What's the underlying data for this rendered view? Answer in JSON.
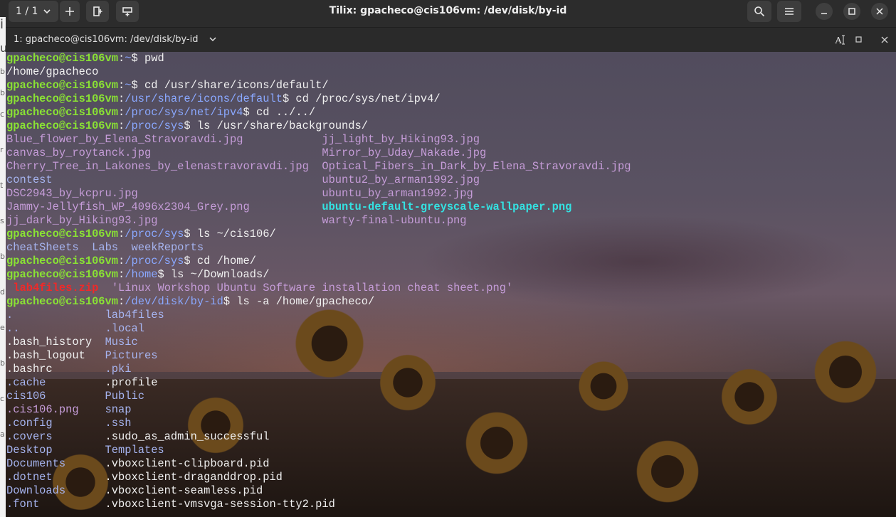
{
  "window": {
    "title": "Tilix: gpacheco@cis106vm: /dev/disk/by-id",
    "session_counter": "1 / 1"
  },
  "terminal": {
    "title": "1: gpacheco@cis106vm: /dev/disk/by-id"
  },
  "icons": [
    "chevron-down-icon",
    "plus-icon",
    "add-terminal-right-icon",
    "add-terminal-down-icon",
    "search-icon",
    "hamburger-menu-icon",
    "minimize-icon",
    "maximize-icon",
    "close-icon",
    "text-cursor-icon",
    "terminal-maximize-icon",
    "terminal-close-icon"
  ],
  "colors": {
    "prompt_user": "#8ae234",
    "prompt_path": "#8aa8ff",
    "directory": "#a6b4f0",
    "image_file": "#c59cd8",
    "link_file": "#34e2e2",
    "archive": "#ef2929"
  },
  "lines": [
    [
      {
        "t": "gpacheco@cis106vm",
        "c": "g"
      },
      {
        "t": ":",
        "c": "plain"
      },
      {
        "t": "~",
        "c": "b"
      },
      {
        "t": "$ pwd",
        "c": "cmd"
      }
    ],
    [
      {
        "t": "/home/gpacheco",
        "c": "plain"
      }
    ],
    [
      {
        "t": "gpacheco@cis106vm",
        "c": "g"
      },
      {
        "t": ":",
        "c": "plain"
      },
      {
        "t": "~",
        "c": "b"
      },
      {
        "t": "$ cd /usr/share/icons/default/",
        "c": "cmd"
      }
    ],
    [
      {
        "t": "gpacheco@cis106vm",
        "c": "g"
      },
      {
        "t": ":",
        "c": "plain"
      },
      {
        "t": "/usr/share/icons/default",
        "c": "b"
      },
      {
        "t": "$ cd /proc/sys/net/ipv4/",
        "c": "cmd"
      }
    ],
    [
      {
        "t": "gpacheco@cis106vm",
        "c": "g"
      },
      {
        "t": ":",
        "c": "plain"
      },
      {
        "t": "/proc/sys/net/ipv4",
        "c": "b"
      },
      {
        "t": "$ cd ../../",
        "c": "cmd"
      }
    ],
    [
      {
        "t": "gpacheco@cis106vm",
        "c": "g"
      },
      {
        "t": ":",
        "c": "plain"
      },
      {
        "t": "/proc/sys",
        "c": "b"
      },
      {
        "t": "$ ls /usr/share/backgrounds/",
        "c": "cmd"
      }
    ],
    [
      {
        "t": "Blue_flower_by_Elena_Stravoravdi.jpg",
        "c": "pk"
      },
      {
        "t": "            ",
        "c": "plain"
      },
      {
        "t": "jj_light_by_Hiking93.jpg",
        "c": "pk"
      }
    ],
    [
      {
        "t": "canvas_by_roytanck.jpg",
        "c": "pk"
      },
      {
        "t": "                          ",
        "c": "plain"
      },
      {
        "t": "Mirror_by_Uday_Nakade.jpg",
        "c": "pk"
      }
    ],
    [
      {
        "t": "Cherry_Tree_in_Lakones_by_elenastravoravdi.jpg",
        "c": "pk"
      },
      {
        "t": "  ",
        "c": "plain"
      },
      {
        "t": "Optical_Fibers_in_Dark_by_Elena_Stravoravdi.jpg",
        "c": "pk"
      }
    ],
    [
      {
        "t": "contest",
        "c": "bl"
      },
      {
        "t": "                                         ",
        "c": "plain"
      },
      {
        "t": "ubuntu2_by_arman1992.jpg",
        "c": "pk"
      }
    ],
    [
      {
        "t": "DSC2943_by_kcpru.jpg",
        "c": "pk"
      },
      {
        "t": "                            ",
        "c": "plain"
      },
      {
        "t": "ubuntu_by_arman1992.jpg",
        "c": "pk"
      }
    ],
    [
      {
        "t": "Jammy-Jellyfish_WP_4096x2304_Grey.png",
        "c": "pk"
      },
      {
        "t": "           ",
        "c": "plain"
      },
      {
        "t": "ubuntu-default-greyscale-wallpaper.png",
        "c": "cy"
      }
    ],
    [
      {
        "t": "jj_dark_by_Hiking93.jpg",
        "c": "pk"
      },
      {
        "t": "                         ",
        "c": "plain"
      },
      {
        "t": "warty-final-ubuntu.png",
        "c": "pk"
      }
    ],
    [
      {
        "t": "gpacheco@cis106vm",
        "c": "g"
      },
      {
        "t": ":",
        "c": "plain"
      },
      {
        "t": "/proc/sys",
        "c": "b"
      },
      {
        "t": "$ ls ~/cis106/",
        "c": "cmd"
      }
    ],
    [
      {
        "t": "cheatSheets",
        "c": "bl"
      },
      {
        "t": "  ",
        "c": "plain"
      },
      {
        "t": "Labs",
        "c": "bl"
      },
      {
        "t": "  ",
        "c": "plain"
      },
      {
        "t": "weekReports",
        "c": "bl"
      }
    ],
    [
      {
        "t": "gpacheco@cis106vm",
        "c": "g"
      },
      {
        "t": ":",
        "c": "plain"
      },
      {
        "t": "/proc/sys",
        "c": "b"
      },
      {
        "t": "$ cd /home/",
        "c": "cmd"
      }
    ],
    [
      {
        "t": "gpacheco@cis106vm",
        "c": "g"
      },
      {
        "t": ":",
        "c": "plain"
      },
      {
        "t": "/home",
        "c": "b"
      },
      {
        "t": "$ ls ~/Downloads/",
        "c": "cmd"
      }
    ],
    [
      {
        "t": " ",
        "c": "plain"
      },
      {
        "t": "lab4files.zip",
        "c": "rd"
      },
      {
        "t": "  ",
        "c": "plain"
      },
      {
        "t": "'Linux Workshop Ubuntu Software installation cheat sheet.png'",
        "c": "pk"
      }
    ],
    [
      {
        "t": "gpacheco@cis106vm",
        "c": "g"
      },
      {
        "t": ":",
        "c": "plain"
      },
      {
        "t": "/dev/disk/by-id",
        "c": "b"
      },
      {
        "t": "$ ls -a /home/gpacheco/",
        "c": "cmd"
      }
    ],
    [
      {
        "t": ".",
        "c": "bl"
      },
      {
        "t": "              ",
        "c": "plain"
      },
      {
        "t": "lab4files",
        "c": "bl"
      }
    ],
    [
      {
        "t": "..",
        "c": "bl"
      },
      {
        "t": "             ",
        "c": "plain"
      },
      {
        "t": ".local",
        "c": "bl"
      }
    ],
    [
      {
        "t": ".bash_history",
        "c": "w"
      },
      {
        "t": "  ",
        "c": "plain"
      },
      {
        "t": "Music",
        "c": "bl"
      }
    ],
    [
      {
        "t": ".bash_logout",
        "c": "w"
      },
      {
        "t": "   ",
        "c": "plain"
      },
      {
        "t": "Pictures",
        "c": "bl"
      }
    ],
    [
      {
        "t": ".bashrc",
        "c": "w"
      },
      {
        "t": "        ",
        "c": "plain"
      },
      {
        "t": ".pki",
        "c": "bl"
      }
    ],
    [
      {
        "t": ".cache",
        "c": "bl"
      },
      {
        "t": "         ",
        "c": "plain"
      },
      {
        "t": ".profile",
        "c": "w"
      }
    ],
    [
      {
        "t": "cis106",
        "c": "bl"
      },
      {
        "t": "         ",
        "c": "plain"
      },
      {
        "t": "Public",
        "c": "bl"
      }
    ],
    [
      {
        "t": ".cis106.png",
        "c": "pk"
      },
      {
        "t": "    ",
        "c": "plain"
      },
      {
        "t": "snap",
        "c": "bl"
      }
    ],
    [
      {
        "t": ".config",
        "c": "bl"
      },
      {
        "t": "        ",
        "c": "plain"
      },
      {
        "t": ".ssh",
        "c": "bl"
      }
    ],
    [
      {
        "t": ".covers",
        "c": "bl"
      },
      {
        "t": "        ",
        "c": "plain"
      },
      {
        "t": ".sudo_as_admin_successful",
        "c": "w"
      }
    ],
    [
      {
        "t": "Desktop",
        "c": "bl"
      },
      {
        "t": "        ",
        "c": "plain"
      },
      {
        "t": "Templates",
        "c": "bl"
      }
    ],
    [
      {
        "t": "Documents",
        "c": "bl"
      },
      {
        "t": "      ",
        "c": "plain"
      },
      {
        "t": ".vboxclient-clipboard.pid",
        "c": "w"
      }
    ],
    [
      {
        "t": ".dotnet",
        "c": "bl"
      },
      {
        "t": "        ",
        "c": "plain"
      },
      {
        "t": ".vboxclient-draganddrop.pid",
        "c": "w"
      }
    ],
    [
      {
        "t": "Downloads",
        "c": "bl"
      },
      {
        "t": "      ",
        "c": "plain"
      },
      {
        "t": ".vboxclient-seamless.pid",
        "c": "w"
      }
    ],
    [
      {
        "t": ".font",
        "c": "bl"
      },
      {
        "t": "          ",
        "c": "plain"
      },
      {
        "t": ".vboxclient-vmsvga-session-tty2.pid",
        "c": "w"
      }
    ]
  ]
}
